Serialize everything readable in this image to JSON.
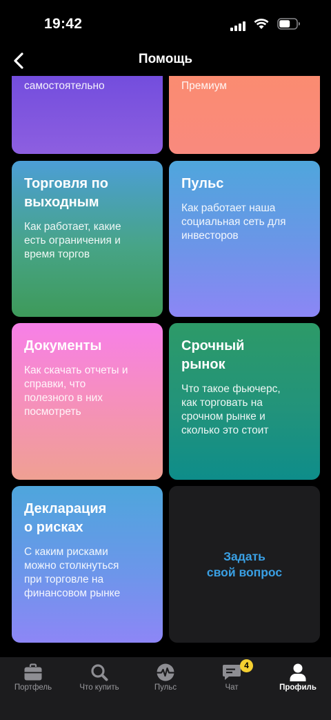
{
  "status_bar": {
    "time": "19:42"
  },
  "header": {
    "title": "Помощь"
  },
  "cards": [
    {
      "desc": "самостоятельно"
    },
    {
      "desc": "Премиум"
    },
    {
      "title": "Торговля по\nвыходным",
      "desc": "Как работает, какие\nесть ограничения и\nвремя торгов"
    },
    {
      "title": "Пульс",
      "desc": "Как работает наша\nсоциальная сеть для\nинвесторов"
    },
    {
      "title": "Документы",
      "desc": "Как скачать отчеты и\nсправки, что\nполезного в них\nпосмотреть"
    },
    {
      "title": "Срочный\nрынок",
      "desc": "Что такое фьючерс,\nкак торговать на\nсрочном рынке и\nсколько это стоит"
    },
    {
      "title": "Декларация\nо рисках",
      "desc": "С каким рисками\nможно столкнуться\nпри торговле на\nфинансовом рынке"
    }
  ],
  "ask_button": {
    "label": "Задать\nсвой вопрос",
    "color": "#3aa0e4"
  },
  "tab_bar": {
    "tabs": [
      {
        "label": "Портфель",
        "icon": "briefcase-icon"
      },
      {
        "label": "Что купить",
        "icon": "search-icon"
      },
      {
        "label": "Пульс",
        "icon": "pulse-icon"
      },
      {
        "label": "Чат",
        "icon": "chat-icon",
        "badge": "4"
      },
      {
        "label": "Профиль",
        "icon": "profile-icon",
        "active": true
      }
    ]
  }
}
